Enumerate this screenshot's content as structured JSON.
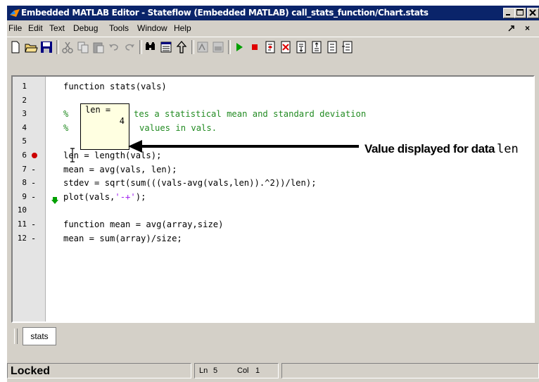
{
  "window": {
    "title": "Embedded MATLAB Editor - Stateflow (Embedded MATLAB) call_stats_function/Chart.stats",
    "mdi_restore": "ᴬ",
    "mdi_close": "×"
  },
  "menu": [
    "File",
    "Edit",
    "Text",
    "Debug",
    "Tools",
    "Window",
    "Help"
  ],
  "toolbar_icons": [
    "new-file-icon",
    "open-folder-icon",
    "save-icon",
    "cut-icon",
    "copy-icon",
    "paste-icon",
    "undo-icon",
    "redo-icon",
    "find-icon",
    "list-icon",
    "go-to-icon",
    "build-icon",
    "compile-icon",
    "run-icon",
    "stop-icon",
    "step-icon",
    "clear-breakpoint-icon",
    "step-in-icon",
    "step-out-icon",
    "step-over-icon",
    "exit-debug-icon"
  ],
  "code_lines": [
    {
      "num": "1",
      "marker": "",
      "text": "function stats(vals)"
    },
    {
      "num": "2",
      "marker": "",
      "text": ""
    },
    {
      "num": "3",
      "marker": "",
      "text": "%"
    },
    {
      "num": "4",
      "marker": "",
      "text": "%"
    },
    {
      "num": "5",
      "marker": "",
      "text": ""
    },
    {
      "num": "6",
      "marker": "breakpoint",
      "text": "len = length(vals);"
    },
    {
      "num": "7",
      "marker": "-",
      "text": "mean = avg(vals, len);"
    },
    {
      "num": "8",
      "marker": "-",
      "text": "stdev = sqrt(sum(((vals-avg(vals,len)).^2))/len);"
    },
    {
      "num": "9",
      "marker": "-",
      "text": "plot(vals,'-+');"
    },
    {
      "num": "10",
      "marker": "",
      "text": ""
    },
    {
      "num": "11",
      "marker": "-",
      "text": "function mean = avg(array,size)"
    },
    {
      "num": "12",
      "marker": "-",
      "text": "mean = sum(array)/size;"
    }
  ],
  "line3_comment_rest": "tes a statistical mean and standard deviation",
  "line4_comment_rest": "values in vals.",
  "tooltip": {
    "name": "len =",
    "value": "4"
  },
  "annotation": {
    "text": "Value displayed for data",
    "var": "len"
  },
  "tab": "stats",
  "status": {
    "state": "Locked",
    "ln_label": "Ln",
    "ln_value": "5",
    "col_label": "Col",
    "col_value": "1"
  },
  "colors": {
    "titlebar": "#0a246a",
    "comment": "#228b22",
    "string": "#a020f0",
    "breakpoint": "#cc0000",
    "tooltip_bg": "#ffffe1"
  }
}
